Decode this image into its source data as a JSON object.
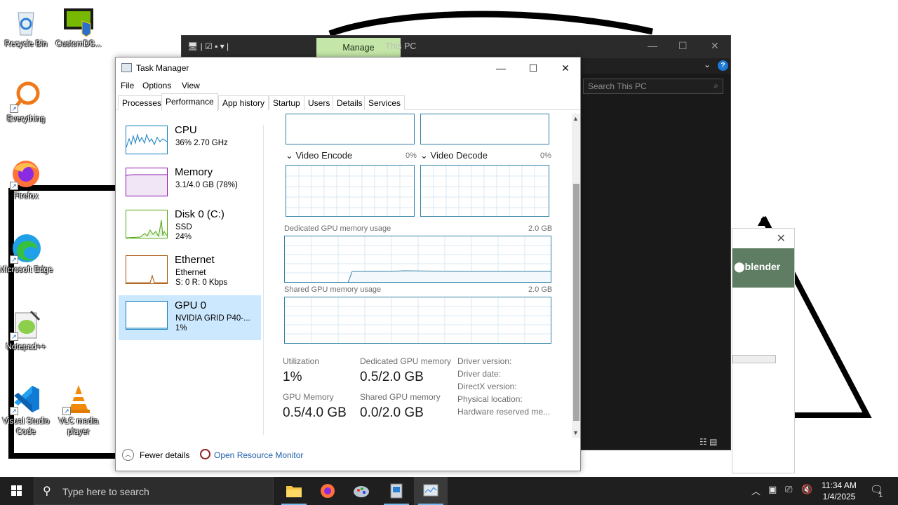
{
  "desktop": {
    "icons": [
      {
        "label": "Recycle Bin"
      },
      {
        "label": "CustomDS..."
      },
      {
        "label": "Everything"
      },
      {
        "label": "Firefox"
      },
      {
        "label": "Microsoft Edge"
      },
      {
        "label": "Notepad++"
      },
      {
        "label": "Visual Studio Code"
      },
      {
        "label": "VLC media player"
      }
    ]
  },
  "explorer": {
    "manage_tab": "Manage",
    "title": "This PC",
    "search_placeholder": "Search This PC"
  },
  "blender": {
    "brand": "blender"
  },
  "taskmanager": {
    "title": "Task Manager",
    "menu": [
      "File",
      "Options",
      "View"
    ],
    "tabs": [
      "Processes",
      "Performance",
      "App history",
      "Startup",
      "Users",
      "Details",
      "Services"
    ],
    "active_tab": "Performance",
    "resources": [
      {
        "name": "CPU",
        "line1": "36% 2.70 GHz",
        "line2": "",
        "color": "#117dbb"
      },
      {
        "name": "Memory",
        "line1": "3.1/4.0 GB (78%)",
        "line2": "",
        "color": "#8b12ae"
      },
      {
        "name": "Disk 0 (C:)",
        "line1": "SSD",
        "line2": "24%",
        "color": "#4da60c"
      },
      {
        "name": "Ethernet",
        "line1": "Ethernet",
        "line2": "S: 0 R: 0 Kbps",
        "color": "#a74f01"
      },
      {
        "name": "GPU 0",
        "line1": "NVIDIA GRID P40-...",
        "line2": "1%",
        "color": "#117dbb",
        "selected": true
      }
    ],
    "gpu": {
      "engines": [
        {
          "name": "Video Encode",
          "pct": "0%"
        },
        {
          "name": "Video Decode",
          "pct": "0%"
        }
      ],
      "dedicated_label": "Dedicated GPU memory usage",
      "dedicated_max": "2.0 GB",
      "shared_label": "Shared GPU memory usage",
      "shared_max": "2.0 GB",
      "stats": {
        "utilization_label": "Utilization",
        "utilization_value": "1%",
        "dedicated_label": "Dedicated GPU memory",
        "dedicated_value": "0.5/2.0 GB",
        "gpu_memory_label": "GPU Memory",
        "gpu_memory_value": "0.5/4.0 GB",
        "shared_label": "Shared GPU memory",
        "shared_value": "0.0/2.0 GB"
      },
      "info": [
        "Driver version:",
        "Driver date:",
        "DirectX version:",
        "Physical location:",
        "Hardware reserved me..."
      ]
    },
    "footer": {
      "fewer_details": "Fewer details",
      "open_resource_monitor": "Open Resource Monitor"
    }
  },
  "taskbar": {
    "search_placeholder": "Type here to search",
    "time": "11:34 AM",
    "date": "1/4/2025",
    "notification_count": "1"
  }
}
